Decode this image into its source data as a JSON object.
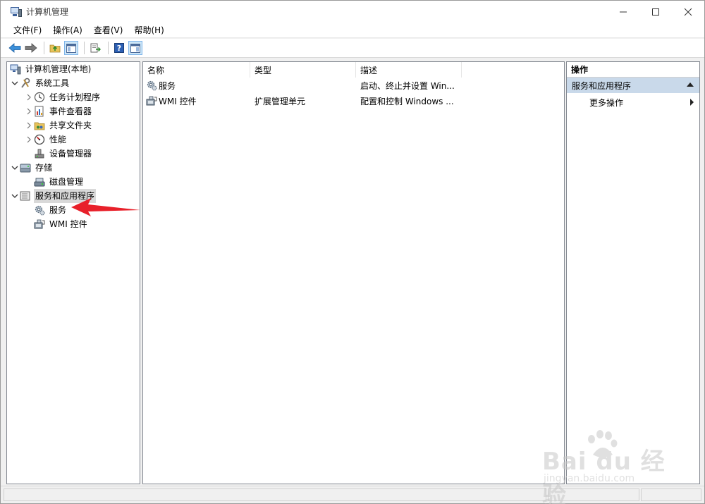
{
  "window": {
    "title": "计算机管理"
  },
  "menubar": {
    "items": [
      "文件(F)",
      "操作(A)",
      "查看(V)",
      "帮助(H)"
    ]
  },
  "tree": {
    "items": [
      {
        "label": "计算机管理(本地)"
      },
      {
        "label": "系统工具"
      },
      {
        "label": "任务计划程序"
      },
      {
        "label": "事件查看器"
      },
      {
        "label": "共享文件夹"
      },
      {
        "label": "性能"
      },
      {
        "label": "设备管理器"
      },
      {
        "label": "存储"
      },
      {
        "label": "磁盘管理"
      },
      {
        "label": "服务和应用程序"
      },
      {
        "label": "服务"
      },
      {
        "label": "WMI 控件"
      }
    ]
  },
  "list": {
    "columns": [
      "名称",
      "类型",
      "描述"
    ],
    "rows": [
      {
        "name": "服务",
        "type": "",
        "desc": "启动、终止并设置 Win..."
      },
      {
        "name": "WMI 控件",
        "type": "扩展管理单元",
        "desc": "配置和控制 Windows ..."
      }
    ]
  },
  "actions": {
    "header": "操作",
    "section": "服务和应用程序",
    "more": "更多操作"
  },
  "watermark": {
    "main": "Bai du 经验",
    "sub": "jingyan.baidu.com"
  },
  "colors": {
    "annotation": "#e8202a",
    "selection": "#d9d9d9",
    "action_section": "#c9d9ea"
  }
}
